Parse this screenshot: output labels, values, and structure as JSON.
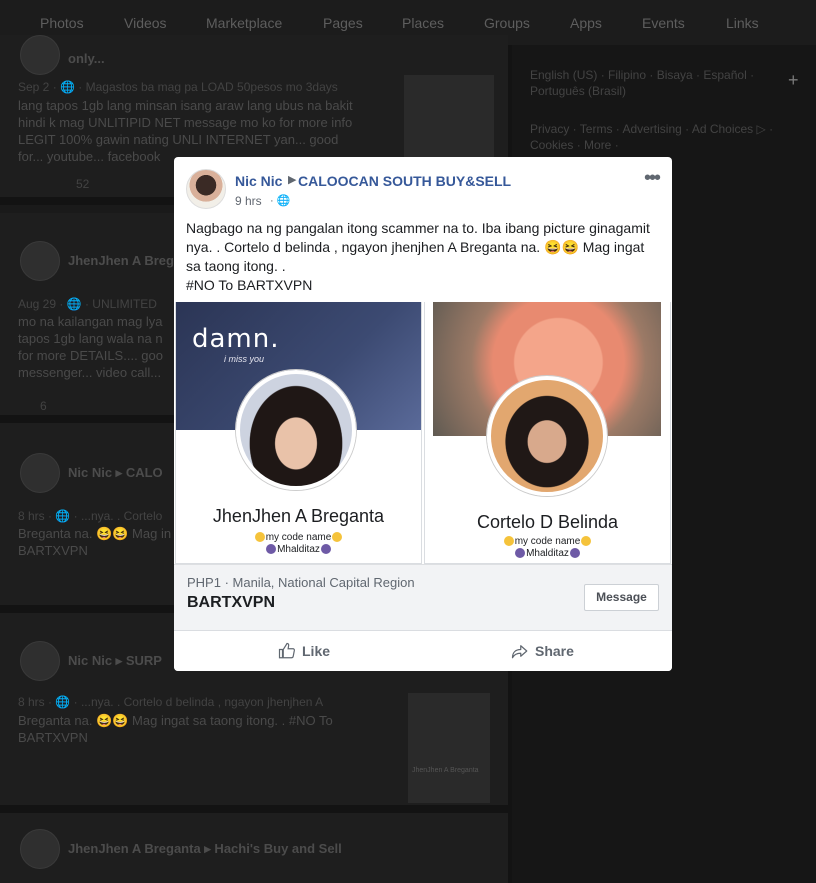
{
  "topnav": {
    "items": [
      "Photos",
      "Videos",
      "Marketplace",
      "Pages",
      "Places",
      "Groups",
      "Apps",
      "Events",
      "Links"
    ]
  },
  "background_feed": {
    "post1": {
      "title_fragment": "only...",
      "meta": "Sep 2 · 🌐 · Magastos ba mag pa LOAD 50pesos mo 3days",
      "text": "lang tapos 1gb lang minsan isang araw lang ubus na bakit\nhindi k mag UNLITIPID NET message mo ko for more info\nLEGIT 100% gawin nating UNLI INTERNET yan... good\nfor... youtube... facebook",
      "reactions": "52"
    },
    "post2": {
      "author": "JhenJhen A Breganta",
      "meta": "Aug 29 · 🌐 · UNLIMITED",
      "text": "mo na kailangan mag lya\ntapos 1gb lang wala na n\nfor more DETAILS.... goo\nmessenger... video call...",
      "reactions": "6"
    },
    "post3": {
      "author": "Nic Nic ▸ CALO",
      "meta": "8 hrs · 🌐 · ...nya. . Cortelo",
      "text": "Breganta na. 😆😆 Mag in\nBARTXVPN"
    },
    "post4": {
      "author": "Nic Nic ▸ SURP",
      "meta": "8 hrs · 🌐 · ...nya. . Cortelo d belinda , ngayon jhenjhen A",
      "text": "Breganta na. 😆😆 Mag ingat sa taong itong. . #NO To\nBARTXVPN",
      "thumb_label": "JhenJhen A Breganta"
    },
    "post5": {
      "author": "JhenJhen A Breganta ▸ Hachi's Buy and Sell"
    }
  },
  "right_column": {
    "languages": "English (US) · Filipino · Bisaya · Español ·\nPortuguês (Brasil)",
    "links": "Privacy · Terms · Advertising · Ad Choices ▷ ·\nCookies · More ·"
  },
  "modal": {
    "author": "Nic Nic",
    "group": "CALOOCAN SOUTH BUY&SELL",
    "time": "9 hrs",
    "privacy_icon": "globe-icon",
    "more_icon": "•••",
    "text": "Nagbago na ng pangalan itong scammer na to. Iba ibang picture ginagamit nya. . Cortelo d belinda , ngayon jhenjhen A Breganta na. 😆😆 Mag ingat sa taong itong. .\n#NO To BARTXVPN",
    "card1": {
      "cover_text": "damn.",
      "cover_sub": "i miss you",
      "name": "JhenJhen A Breganta",
      "bio1": "my code name",
      "bio2": "Mhalditaz"
    },
    "card2": {
      "name": "Cortelo D Belinda",
      "bio1": "my code name",
      "bio2": "Mhalditaz"
    },
    "ad": {
      "subtitle": "PHP1 · Manila, National Capital Region",
      "title": "BARTXVPN",
      "button": "Message"
    },
    "actions": {
      "like": "Like",
      "share": "Share"
    }
  },
  "colors": {
    "link_blue": "#365899",
    "overlay": "#131313"
  }
}
